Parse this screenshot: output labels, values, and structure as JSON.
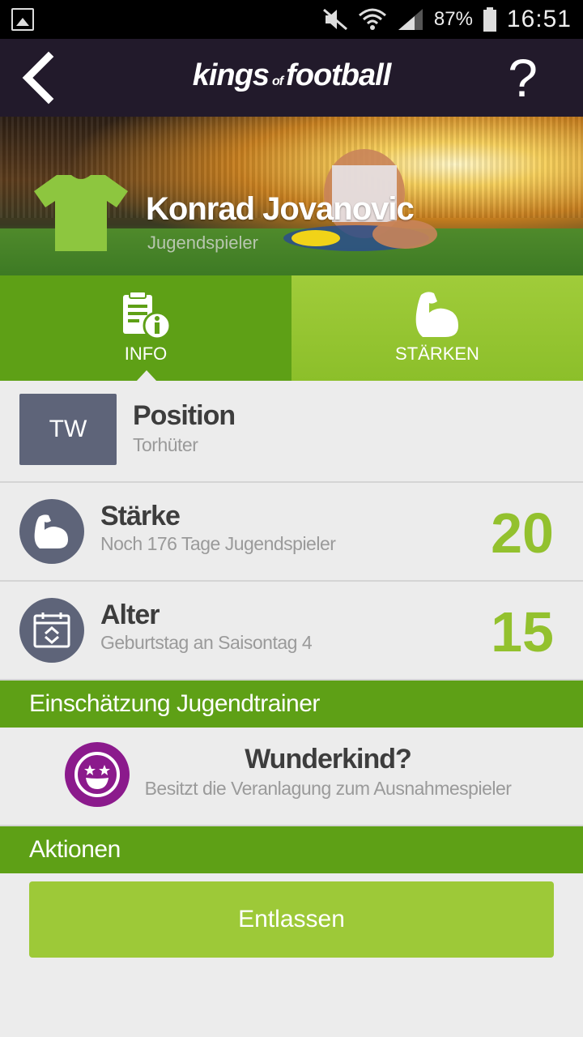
{
  "status_bar": {
    "battery_percent": "87%",
    "time": "16:51",
    "icons": [
      "gallery-icon",
      "mute-icon",
      "wifi-icon",
      "signal-icon",
      "battery-icon"
    ]
  },
  "app_bar": {
    "logo_left": "kings",
    "logo_of": "of",
    "logo_right": "football",
    "help_label": "?",
    "icons": [
      "back-chevron-icon",
      "help-icon"
    ]
  },
  "player": {
    "name": "Konrad Jovanovic",
    "role": "Jugendspieler",
    "shirt_color": "#8dc63f"
  },
  "tabs": [
    {
      "label": "INFO",
      "icon": "info-document-icon",
      "active": true
    },
    {
      "label": "STÄRKEN",
      "icon": "muscle-arm-icon",
      "active": false
    }
  ],
  "position": {
    "badge": "TW",
    "title": "Position",
    "subtitle": "Torhüter"
  },
  "strength": {
    "title": "Stärke",
    "subtitle": "Noch 176 Tage Jugendspieler",
    "value": "20",
    "icon": "muscle-arm-icon"
  },
  "age": {
    "title": "Alter",
    "subtitle": "Geburtstag an Saisontag 4",
    "value": "15",
    "icon": "calendar-icon"
  },
  "assessment_section": {
    "label": "Einschätzung Jugendtrainer"
  },
  "assessment": {
    "title": "Wunderkind?",
    "subtitle": "Besitzt die Veranlagung zum Ausnahmespieler",
    "icon": "star-eyes-smiley-icon",
    "icon_color": "#8b1a8c"
  },
  "actions_section": {
    "label": "Aktionen"
  },
  "actions": {
    "dismiss_label": "Entlassen"
  },
  "colors": {
    "accent_green": "#5ea016",
    "light_green": "#9dc938",
    "value_green": "#93c12e",
    "dark_header": "#221a2b",
    "badge_gray": "#5e6479"
  }
}
